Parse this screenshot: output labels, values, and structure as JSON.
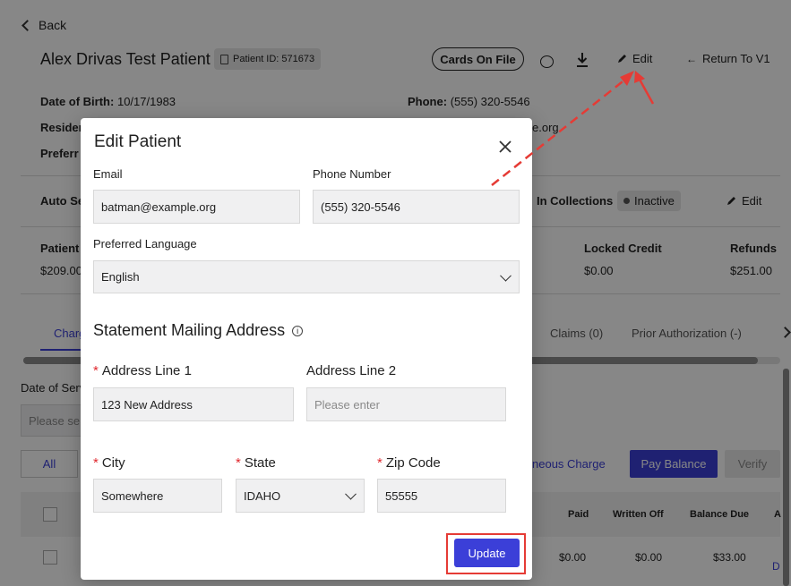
{
  "background": {
    "back_label": "Back",
    "patient_name": "Alex Drivas Test Patient",
    "patient_id": "Patient ID: 571673",
    "cards_on_file": "Cards On File",
    "edit_label": "Edit",
    "return_label": "Return To V1",
    "dob_label": "Date of Birth:",
    "dob_value": "10/17/1983",
    "phone_label": "Phone:",
    "phone_value": "(555) 320-5546",
    "resident_label_partial": "Resider",
    "email_partial": "e.org",
    "preferred_partial": "Preferr",
    "auto_partial": "Auto Se",
    "in_collections_label": "In Collections",
    "inactive_label": "Inactive",
    "edit2_label": "Edit",
    "patient_partial": "Patient",
    "patient_amount_partial": "$209.00",
    "locked_credit_label": "Locked Credit",
    "locked_credit_value": "$0.00",
    "refunds_label": "Refunds",
    "refunds_value": "$251.00",
    "tab_charges_partial": "Charg",
    "tab_claims": "Claims (0)",
    "tab_prior_auth": "Prior Authorization (-)",
    "date_of_service_partial": "Date of Serv",
    "please_select_partial": "Please sel",
    "all_label": "All",
    "misc_charge_partial": "neous Charge",
    "pay_balance": "Pay Balance",
    "verify": "Verify",
    "table_headers": [
      "Paid",
      "Written Off",
      "Balance Due",
      "A"
    ],
    "table_row": [
      "$0.00",
      "$0.00",
      "$33.00",
      "D"
    ]
  },
  "modal": {
    "title": "Edit Patient",
    "email_label": "Email",
    "email_value": "batman@example.org",
    "phone_label": "Phone Number",
    "phone_value": "(555) 320-5546",
    "language_label": "Preferred Language",
    "language_value": "English",
    "section_title": "Statement Mailing Address",
    "addr1_label": "Address Line 1",
    "addr1_value": "123 New Address",
    "addr2_label": "Address Line 2",
    "addr2_placeholder": "Please enter",
    "city_label": "City",
    "city_value": "Somewhere",
    "state_label": "State",
    "state_value": "IDAHO",
    "zip_label": "Zip Code",
    "zip_value": "55555",
    "update_button": "Update",
    "required_mark": "*"
  },
  "colors": {
    "accent": "#3b3fd8",
    "annotation": "#e53b35"
  }
}
